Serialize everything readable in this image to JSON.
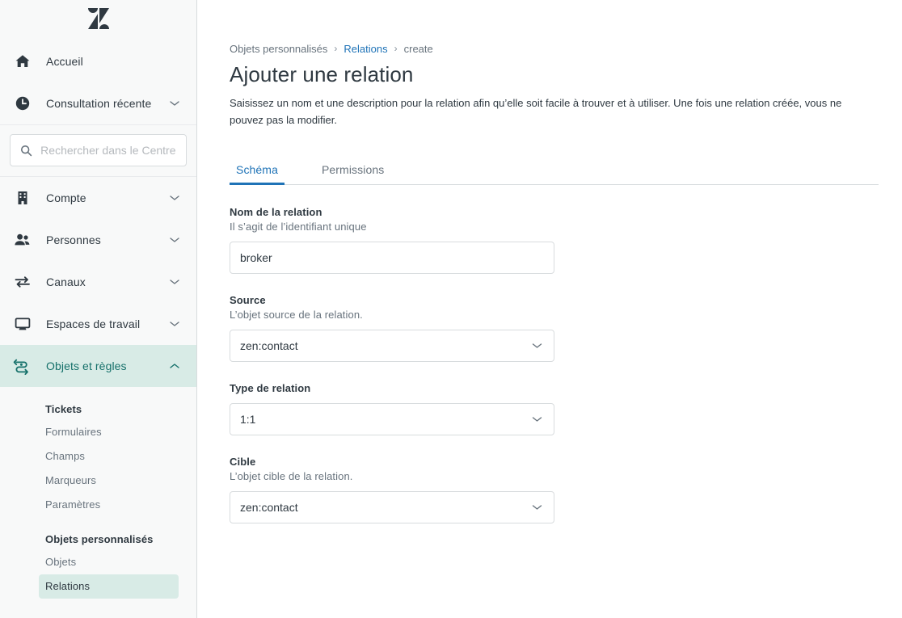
{
  "brand": {
    "logo_name": "zendesk-logo"
  },
  "sidebar": {
    "search": {
      "placeholder": "Rechercher dans le Centre d",
      "value": "",
      "icon": "search-icon"
    },
    "primary_items": [
      {
        "label": "Accueil",
        "icon": "home-icon",
        "expandable": false,
        "active": false
      },
      {
        "label": "Consultation récente",
        "icon": "clock-icon",
        "expandable": true,
        "chevron": "chevron-down-icon",
        "active": false
      }
    ],
    "section_items": [
      {
        "label": "Compte",
        "icon": "building-icon",
        "expandable": true,
        "chevron": "chevron-down-icon",
        "active": false
      },
      {
        "label": "Personnes",
        "icon": "people-icon",
        "expandable": true,
        "chevron": "chevron-down-icon",
        "active": false
      },
      {
        "label": "Canaux",
        "icon": "channels-arrows-icon",
        "expandable": true,
        "chevron": "chevron-down-icon",
        "active": false
      },
      {
        "label": "Espaces de travail",
        "icon": "monitor-icon",
        "expandable": true,
        "chevron": "chevron-down-icon",
        "active": false
      },
      {
        "label": "Objets et règles",
        "icon": "objects-rules-icon",
        "expandable": true,
        "chevron": "chevron-up-icon",
        "active": true
      }
    ],
    "subnav": [
      {
        "title": "Tickets",
        "items": [
          {
            "label": "Formulaires",
            "selected": false
          },
          {
            "label": "Champs",
            "selected": false
          },
          {
            "label": "Marqueurs",
            "selected": false
          },
          {
            "label": "Paramètres",
            "selected": false
          }
        ]
      },
      {
        "title": "Objets personnalisés",
        "items": [
          {
            "label": "Objets",
            "selected": false
          },
          {
            "label": "Relations",
            "selected": true
          }
        ]
      }
    ]
  },
  "main": {
    "breadcrumb": [
      {
        "label": "Objets personnalisés",
        "is_link": false
      },
      {
        "label": "Relations",
        "is_link": true
      },
      {
        "label": "create",
        "is_link": false
      }
    ],
    "breadcrumb_separator": "›",
    "title": "Ajouter une relation",
    "description": "Saisissez un nom et une description pour la relation afin qu’elle soit facile à trouver et à utiliser. Une fois une relation créée, vous ne pouvez pas la modifier.",
    "tabs": [
      {
        "label": "Schéma",
        "active": true
      },
      {
        "label": "Permissions",
        "active": false
      }
    ],
    "fields": [
      {
        "label": "Nom de la relation",
        "hint": "Il s’agit de l’identifiant unique",
        "control": "input",
        "value": "broker",
        "placeholder": ""
      },
      {
        "label": "Source",
        "hint": "L’objet source de la relation.",
        "control": "select",
        "value": "zen:contact",
        "chevron": "chevron-down-icon"
      },
      {
        "label": "Type de relation",
        "hint": "",
        "control": "select",
        "value": "1:1",
        "chevron": "chevron-down-icon"
      },
      {
        "label": "Cible",
        "hint": "L’objet cible de la relation.",
        "control": "select",
        "value": "zen:contact",
        "chevron": "chevron-down-icon"
      }
    ]
  },
  "colors": {
    "accent_blue": "#1f73b7",
    "active_teal_bg": "#d8ebe6",
    "active_teal_fg": "#15706a",
    "text": "#2f3941",
    "muted_text": "#68737d",
    "border": "#d8dcde",
    "sidebar_bg": "#f8f9f9"
  }
}
